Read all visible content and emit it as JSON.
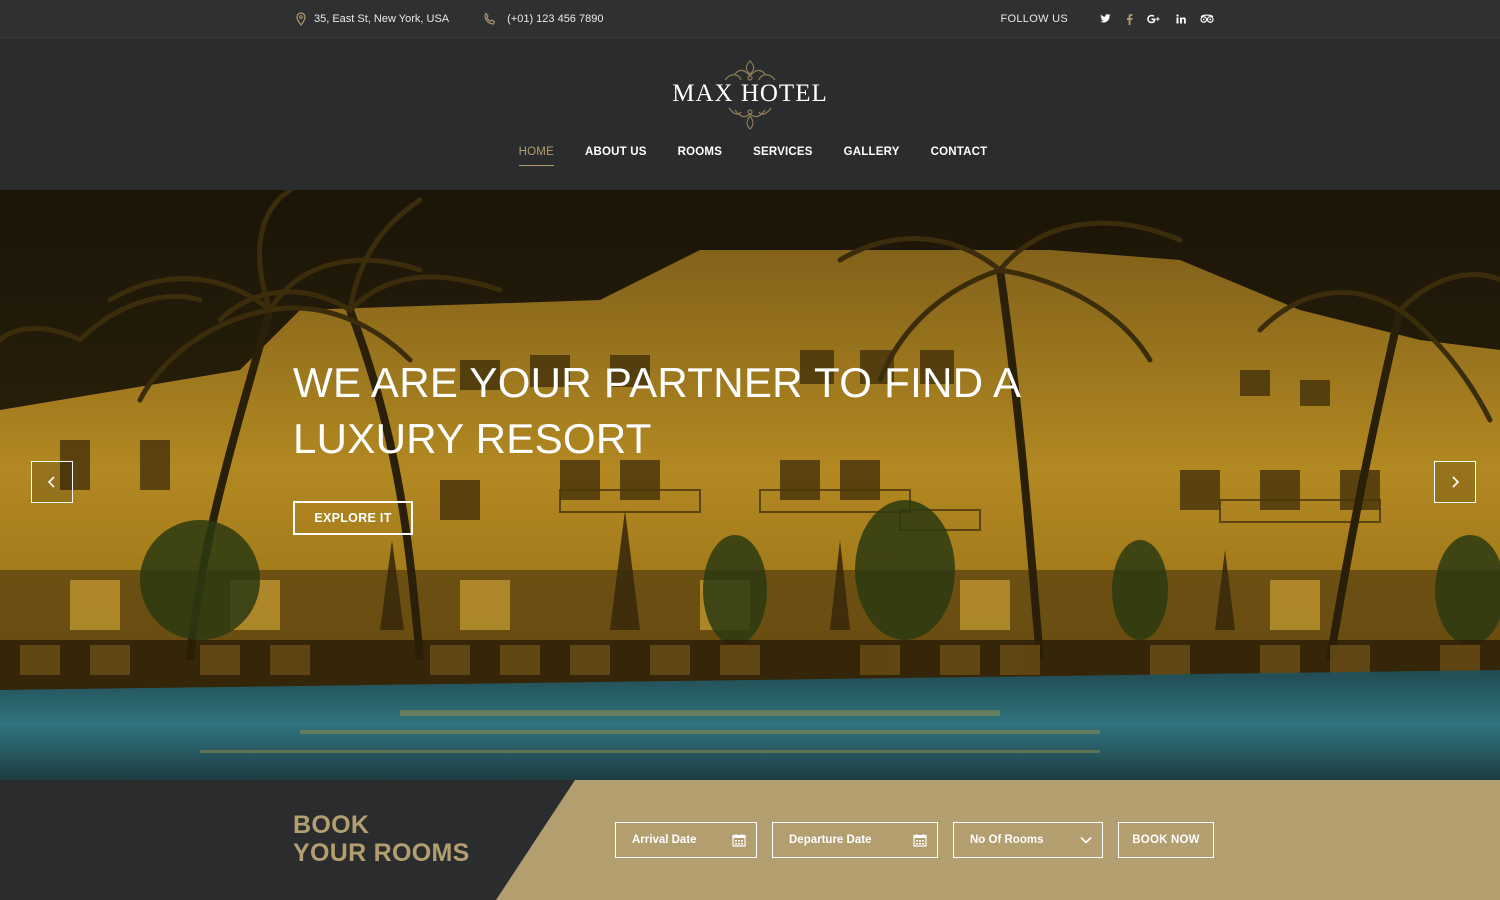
{
  "topbar": {
    "address": "35, East St, New York, USA",
    "phone": "(+01) 123 456 7890",
    "follow_label": "FOLLOW US",
    "social_icons": [
      "twitter-icon",
      "facebook-icon",
      "google-plus-icon",
      "linkedin-icon",
      "tripadvisor-icon"
    ]
  },
  "header": {
    "logo_text": "MAX HOTEL",
    "nav": [
      "HOME",
      "ABOUT US",
      "ROOMS",
      "SERVICES",
      "GALLERY",
      "CONTACT"
    ],
    "active_nav": "HOME"
  },
  "hero": {
    "title_line1": "WE ARE YOUR PARTNER TO FIND A",
    "title_line2": "LUXURY RESORT",
    "cta": "EXPLORE IT"
  },
  "booking": {
    "title_line1": "BOOK",
    "title_line2": "YOUR ROOMS",
    "arrival_placeholder": "Arrival Date",
    "departure_placeholder": "Departure Date",
    "rooms_select": "No Of Rooms",
    "submit": "BOOK NOW"
  },
  "colors": {
    "accent_gold": "#b39e6f",
    "dark_bg": "#2b2c2e",
    "topbar_bg": "#2f3032"
  }
}
